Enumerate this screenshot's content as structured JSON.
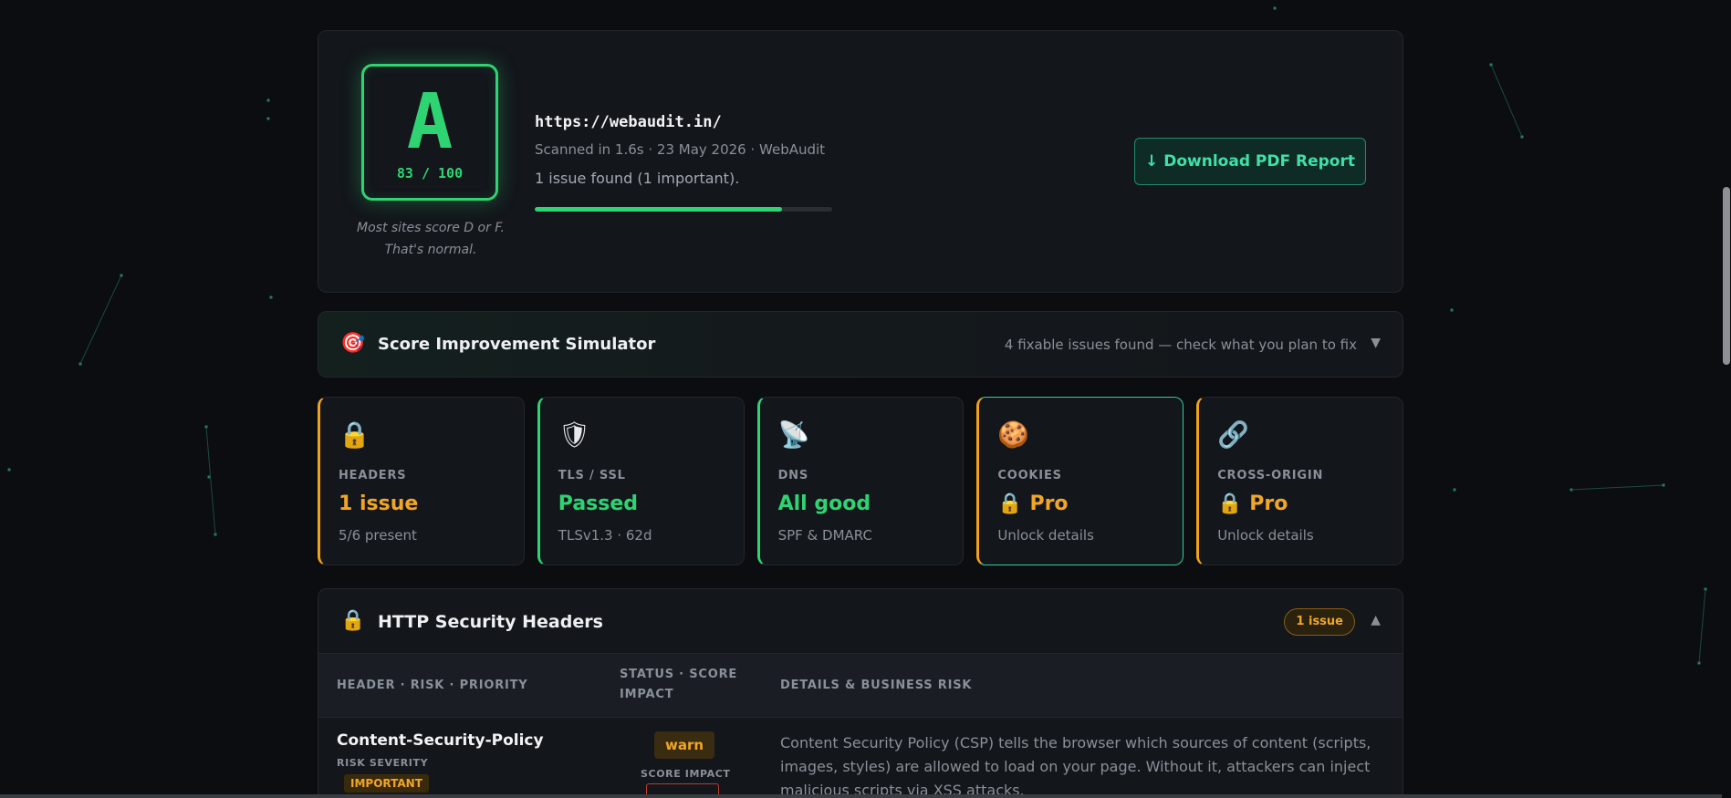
{
  "score": {
    "grade": "A",
    "score_text": "83 / 100",
    "note": "Most sites score D or F. That's normal.",
    "url": "https://webaudit.in/",
    "scan_meta": "Scanned in 1.6s · 23 May 2026 · WebAudit",
    "issue_summary": "1 issue found (1 important).",
    "progress_fraction": 0.83,
    "accent_color": "#2ed472",
    "download_icon": "arrow-down-icon",
    "download_label": "Download PDF Report"
  },
  "simulator": {
    "icon": "target-icon",
    "title": "Score Improvement Simulator",
    "hint": "4 fixable issues found — check what you plan to fix",
    "caret": "▼"
  },
  "categories": [
    {
      "icon": "🔒",
      "icon_name": "lock-icon",
      "label": "HEADERS",
      "value": "1 issue",
      "sub": "5/6 present",
      "tone": "amber"
    },
    {
      "icon": "🛡",
      "icon_name": "shield-icon",
      "label": "TLS / SSL",
      "value": "Passed",
      "sub": "TLSv1.3 · 62d",
      "tone": "green"
    },
    {
      "icon": "📡",
      "icon_name": "satellite-dish-icon",
      "label": "DNS",
      "value": "All good",
      "sub": "SPF & DMARC",
      "tone": "green"
    },
    {
      "icon": "🍪",
      "icon_name": "cookie-icon",
      "label": "COOKIES",
      "value": "🔒 Pro",
      "sub": "Unlock details",
      "tone": "amber"
    },
    {
      "icon": "🔗",
      "icon_name": "link-icon",
      "label": "CROSS-ORIGIN",
      "value": "🔒 Pro",
      "sub": "Unlock details",
      "tone": "amber"
    }
  ],
  "headers_section": {
    "icon": "lock-icon",
    "title": "HTTP Security Headers",
    "badge": "1 issue",
    "caret": "▲",
    "columns": [
      "HEADER · RISK · PRIORITY",
      "STATUS · SCORE IMPACT",
      "DETAILS & BUSINESS RISK"
    ],
    "rows": [
      {
        "name": "Content-Security-Policy",
        "risk_label": "RISK SEVERITY",
        "priority": "IMPORTANT",
        "status": "warn",
        "impact_label": "SCORE IMPACT",
        "details": "Content Security Policy (CSP) tells the browser which sources of content (scripts, images, styles) are allowed to load on your page. Without it, attackers can inject malicious scripts via XSS attacks."
      }
    ]
  }
}
